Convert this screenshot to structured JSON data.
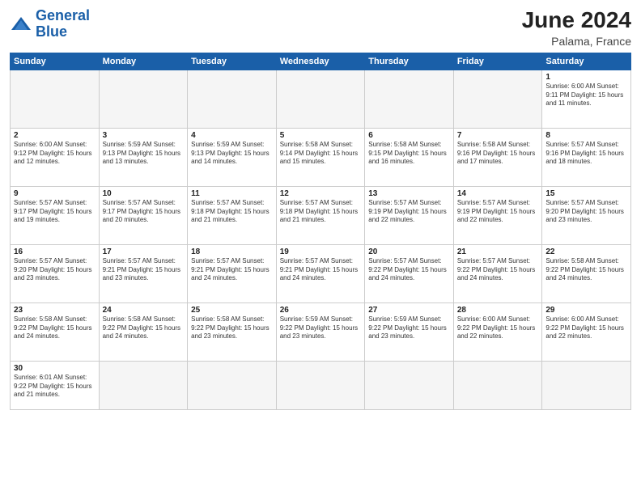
{
  "header": {
    "logo_general": "General",
    "logo_blue": "Blue",
    "main_title": "June 2024",
    "sub_title": "Palama, France"
  },
  "weekdays": [
    "Sunday",
    "Monday",
    "Tuesday",
    "Wednesday",
    "Thursday",
    "Friday",
    "Saturday"
  ],
  "weeks": [
    [
      {
        "day": "",
        "info": "",
        "empty": true
      },
      {
        "day": "",
        "info": "",
        "empty": true
      },
      {
        "day": "",
        "info": "",
        "empty": true
      },
      {
        "day": "",
        "info": "",
        "empty": true
      },
      {
        "day": "",
        "info": "",
        "empty": true
      },
      {
        "day": "",
        "info": "",
        "empty": true
      },
      {
        "day": "1",
        "info": "Sunrise: 6:00 AM\nSunset: 9:11 PM\nDaylight: 15 hours\nand 11 minutes.",
        "empty": false
      }
    ],
    [
      {
        "day": "2",
        "info": "Sunrise: 6:00 AM\nSunset: 9:12 PM\nDaylight: 15 hours\nand 12 minutes.",
        "empty": false
      },
      {
        "day": "3",
        "info": "Sunrise: 5:59 AM\nSunset: 9:13 PM\nDaylight: 15 hours\nand 13 minutes.",
        "empty": false
      },
      {
        "day": "4",
        "info": "Sunrise: 5:59 AM\nSunset: 9:13 PM\nDaylight: 15 hours\nand 14 minutes.",
        "empty": false
      },
      {
        "day": "5",
        "info": "Sunrise: 5:58 AM\nSunset: 9:14 PM\nDaylight: 15 hours\nand 15 minutes.",
        "empty": false
      },
      {
        "day": "6",
        "info": "Sunrise: 5:58 AM\nSunset: 9:15 PM\nDaylight: 15 hours\nand 16 minutes.",
        "empty": false
      },
      {
        "day": "7",
        "info": "Sunrise: 5:58 AM\nSunset: 9:16 PM\nDaylight: 15 hours\nand 17 minutes.",
        "empty": false
      },
      {
        "day": "8",
        "info": "Sunrise: 5:57 AM\nSunset: 9:16 PM\nDaylight: 15 hours\nand 18 minutes.",
        "empty": false
      }
    ],
    [
      {
        "day": "9",
        "info": "Sunrise: 5:57 AM\nSunset: 9:17 PM\nDaylight: 15 hours\nand 19 minutes.",
        "empty": false
      },
      {
        "day": "10",
        "info": "Sunrise: 5:57 AM\nSunset: 9:17 PM\nDaylight: 15 hours\nand 20 minutes.",
        "empty": false
      },
      {
        "day": "11",
        "info": "Sunrise: 5:57 AM\nSunset: 9:18 PM\nDaylight: 15 hours\nand 21 minutes.",
        "empty": false
      },
      {
        "day": "12",
        "info": "Sunrise: 5:57 AM\nSunset: 9:18 PM\nDaylight: 15 hours\nand 21 minutes.",
        "empty": false
      },
      {
        "day": "13",
        "info": "Sunrise: 5:57 AM\nSunset: 9:19 PM\nDaylight: 15 hours\nand 22 minutes.",
        "empty": false
      },
      {
        "day": "14",
        "info": "Sunrise: 5:57 AM\nSunset: 9:19 PM\nDaylight: 15 hours\nand 22 minutes.",
        "empty": false
      },
      {
        "day": "15",
        "info": "Sunrise: 5:57 AM\nSunset: 9:20 PM\nDaylight: 15 hours\nand 23 minutes.",
        "empty": false
      }
    ],
    [
      {
        "day": "16",
        "info": "Sunrise: 5:57 AM\nSunset: 9:20 PM\nDaylight: 15 hours\nand 23 minutes.",
        "empty": false
      },
      {
        "day": "17",
        "info": "Sunrise: 5:57 AM\nSunset: 9:21 PM\nDaylight: 15 hours\nand 23 minutes.",
        "empty": false
      },
      {
        "day": "18",
        "info": "Sunrise: 5:57 AM\nSunset: 9:21 PM\nDaylight: 15 hours\nand 24 minutes.",
        "empty": false
      },
      {
        "day": "19",
        "info": "Sunrise: 5:57 AM\nSunset: 9:21 PM\nDaylight: 15 hours\nand 24 minutes.",
        "empty": false
      },
      {
        "day": "20",
        "info": "Sunrise: 5:57 AM\nSunset: 9:22 PM\nDaylight: 15 hours\nand 24 minutes.",
        "empty": false
      },
      {
        "day": "21",
        "info": "Sunrise: 5:57 AM\nSunset: 9:22 PM\nDaylight: 15 hours\nand 24 minutes.",
        "empty": false
      },
      {
        "day": "22",
        "info": "Sunrise: 5:58 AM\nSunset: 9:22 PM\nDaylight: 15 hours\nand 24 minutes.",
        "empty": false
      }
    ],
    [
      {
        "day": "23",
        "info": "Sunrise: 5:58 AM\nSunset: 9:22 PM\nDaylight: 15 hours\nand 24 minutes.",
        "empty": false
      },
      {
        "day": "24",
        "info": "Sunrise: 5:58 AM\nSunset: 9:22 PM\nDaylight: 15 hours\nand 24 minutes.",
        "empty": false
      },
      {
        "day": "25",
        "info": "Sunrise: 5:58 AM\nSunset: 9:22 PM\nDaylight: 15 hours\nand 23 minutes.",
        "empty": false
      },
      {
        "day": "26",
        "info": "Sunrise: 5:59 AM\nSunset: 9:22 PM\nDaylight: 15 hours\nand 23 minutes.",
        "empty": false
      },
      {
        "day": "27",
        "info": "Sunrise: 5:59 AM\nSunset: 9:22 PM\nDaylight: 15 hours\nand 23 minutes.",
        "empty": false
      },
      {
        "day": "28",
        "info": "Sunrise: 6:00 AM\nSunset: 9:22 PM\nDaylight: 15 hours\nand 22 minutes.",
        "empty": false
      },
      {
        "day": "29",
        "info": "Sunrise: 6:00 AM\nSunset: 9:22 PM\nDaylight: 15 hours\nand 22 minutes.",
        "empty": false
      }
    ],
    [
      {
        "day": "30",
        "info": "Sunrise: 6:01 AM\nSunset: 9:22 PM\nDaylight: 15 hours\nand 21 minutes.",
        "empty": false,
        "last": true
      },
      {
        "day": "",
        "info": "",
        "empty": true,
        "last": true
      },
      {
        "day": "",
        "info": "",
        "empty": true,
        "last": true
      },
      {
        "day": "",
        "info": "",
        "empty": true,
        "last": true
      },
      {
        "day": "",
        "info": "",
        "empty": true,
        "last": true
      },
      {
        "day": "",
        "info": "",
        "empty": true,
        "last": true
      },
      {
        "day": "",
        "info": "",
        "empty": true,
        "last": true
      }
    ]
  ]
}
